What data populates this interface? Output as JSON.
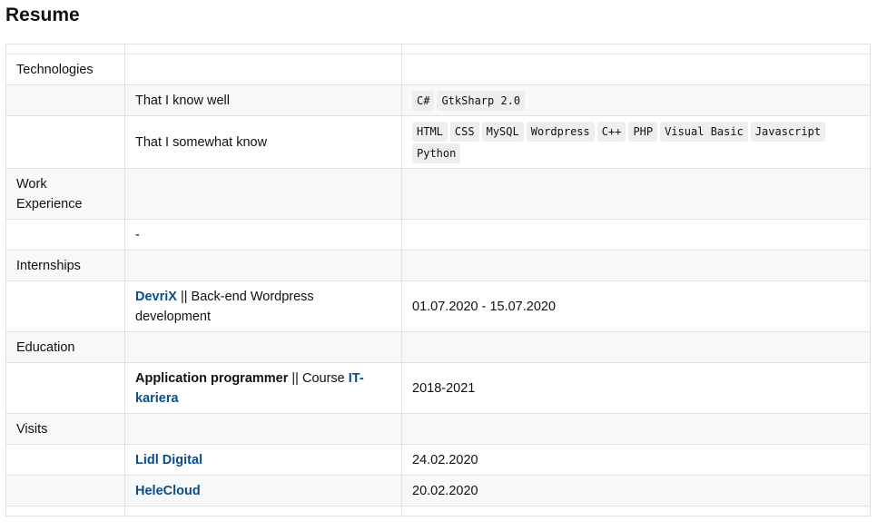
{
  "page": {
    "title": "Resume"
  },
  "sections": {
    "technologies": {
      "label": "Technologies",
      "know_well": {
        "label": "That I know well",
        "tags": [
          "C#",
          "GtkSharp 2.0"
        ]
      },
      "somewhat": {
        "label": "That I somewhat know",
        "tags": [
          "HTML",
          "CSS",
          "MySQL",
          "Wordpress",
          "C++",
          "PHP",
          "Visual Basic",
          "Javascript",
          "Python"
        ]
      }
    },
    "work": {
      "label": "Work Experience",
      "entry": "-"
    },
    "internships": {
      "label": "Internships",
      "items": [
        {
          "company": "DevriX",
          "separator": " || ",
          "role": "Back-end Wordpress development",
          "dates": "01.07.2020 - 15.07.2020"
        }
      ]
    },
    "education": {
      "label": "Education",
      "items": [
        {
          "title": "Application programmer",
          "separator": " || Course ",
          "course": "IT-kariera",
          "dates": "2018-2021"
        }
      ]
    },
    "visits": {
      "label": "Visits",
      "items": [
        {
          "name": "Lidl Digital",
          "date": "24.02.2020"
        },
        {
          "name": "HeleCloud",
          "date": "20.02.2020"
        }
      ]
    }
  }
}
